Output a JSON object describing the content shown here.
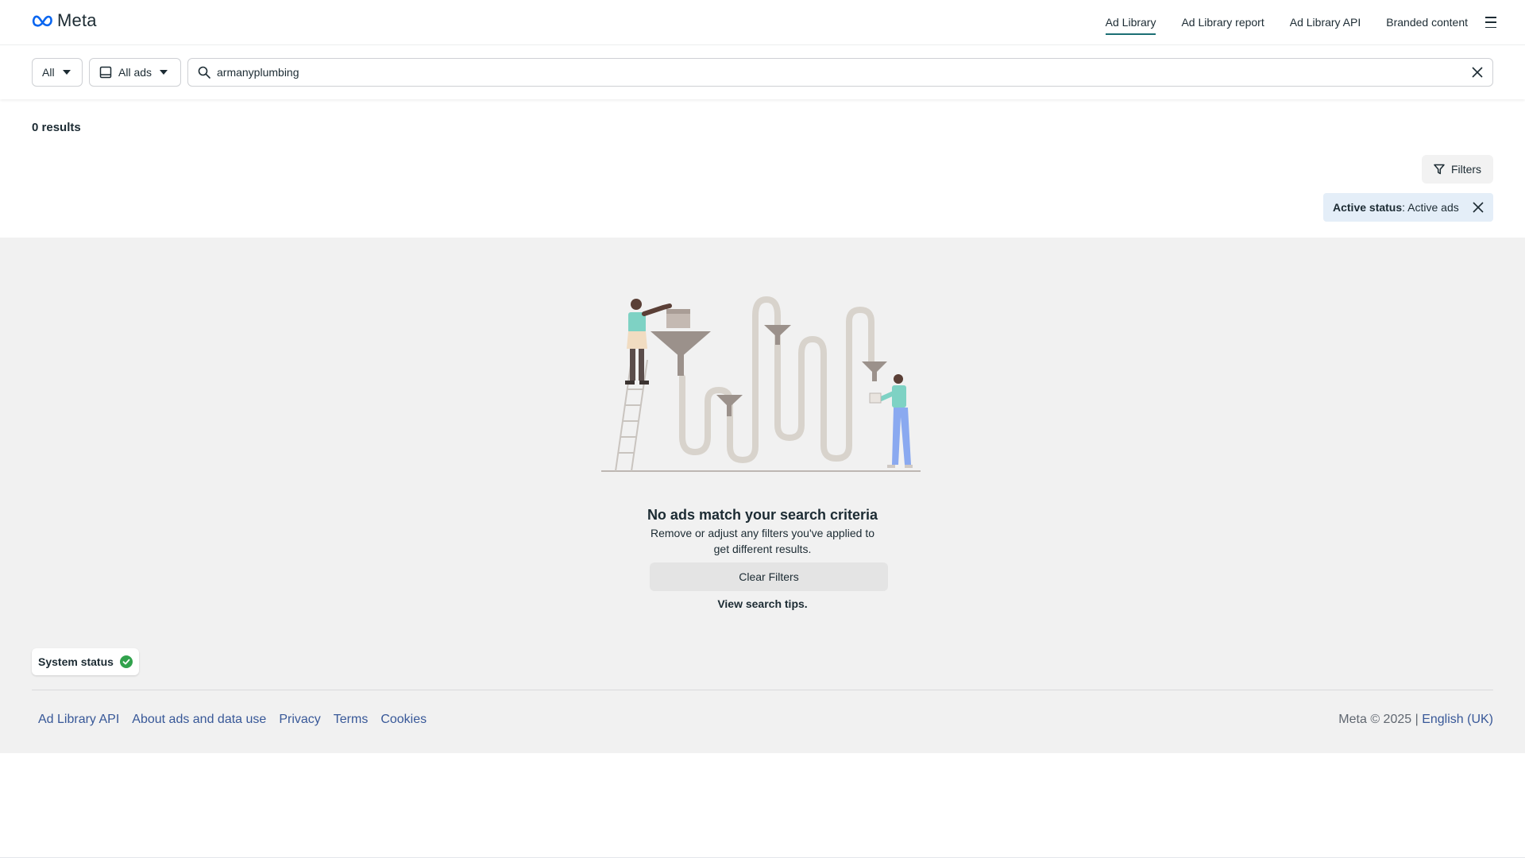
{
  "header": {
    "logo_text": "Meta",
    "nav": [
      {
        "label": "Ad Library",
        "active": true
      },
      {
        "label": "Ad Library report"
      },
      {
        "label": "Ad Library API"
      },
      {
        "label": "Branded content"
      }
    ],
    "menu_icon": "hamburger-icon"
  },
  "search": {
    "country_filter": "All",
    "ad_category": "All ads",
    "query": "armanyplumbing",
    "search_icon": "search-icon",
    "clear_icon": "close-icon"
  },
  "results": {
    "count_label": "0 results",
    "filters_label": "Filters",
    "active_filter": {
      "key": "Active status",
      "value": ": Active ads"
    }
  },
  "empty_state": {
    "title": "No ads match your search criteria",
    "subtitle": "Remove or adjust any filters you've applied to get different results.",
    "clear_button": "Clear Filters",
    "tips_link": "View search tips."
  },
  "system_status": {
    "label": "System status",
    "state_icon": "check-circle-icon",
    "color": "#31a24c"
  },
  "footer": {
    "links": [
      "Ad Library API",
      "About ads and data use",
      "Privacy",
      "Terms",
      "Cookies"
    ],
    "copyright": "Meta © 2025 | ",
    "language": "English (UK)"
  },
  "colors": {
    "accent": "#1c6e74",
    "link": "#385898",
    "chip_bg": "#e4eef8",
    "page_grey": "#f1f1f1"
  }
}
